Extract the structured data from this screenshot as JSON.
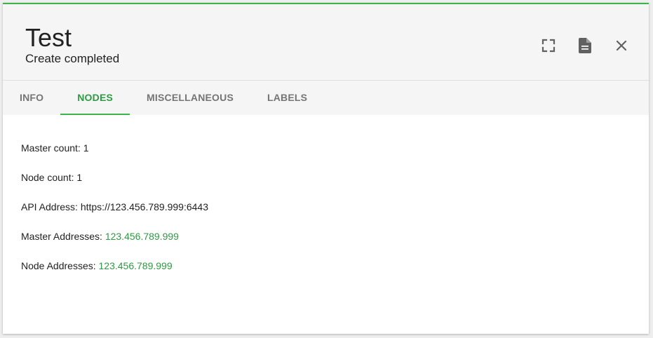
{
  "header": {
    "title": "Test",
    "subtitle": "Create completed",
    "actions": [
      {
        "icon": "fullscreen-icon",
        "name": "fullscreen-button"
      },
      {
        "icon": "document-icon",
        "name": "document-button"
      },
      {
        "icon": "close-icon",
        "name": "close-button"
      }
    ]
  },
  "tabs": [
    {
      "label": "INFO",
      "active": false
    },
    {
      "label": "NODES",
      "active": true
    },
    {
      "label": "MISCELLANEOUS",
      "active": false
    },
    {
      "label": "LABELS",
      "active": false
    }
  ],
  "nodes": {
    "master_count_label": "Master count: ",
    "master_count_value": "1",
    "node_count_label": "Node count: ",
    "node_count_value": "1",
    "api_address_label": "API Address: ",
    "api_address_value": "https://123.456.789.999:6443",
    "master_addresses_label": "Master Addresses: ",
    "master_addresses_value": "123.456.789.999",
    "node_addresses_label": "Node Addresses: ",
    "node_addresses_value": "123.456.789.999"
  },
  "colors": {
    "accent": "#3bb54a",
    "accent_text": "#2e9a43",
    "header_bg": "#f5f5f5",
    "text": "#222222",
    "tab_inactive": "#757575"
  }
}
